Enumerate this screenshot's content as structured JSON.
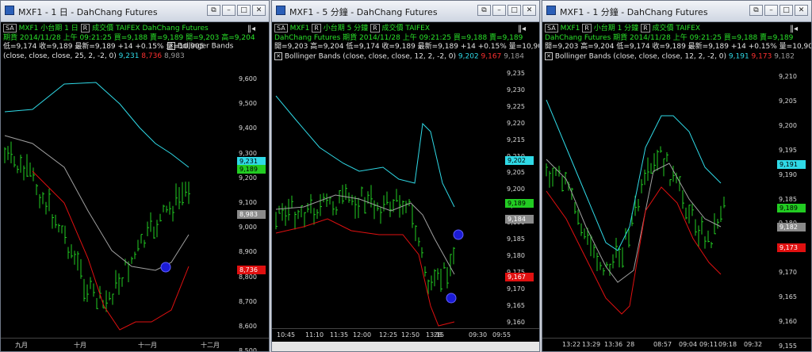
{
  "windows": [
    {
      "title": "MXF1 - 1 日 - DahChang Futures",
      "tab": "SA",
      "line1": {
        "sym": "MXF1",
        "name": "小台期 1 日",
        "btn": "R",
        "kind": "成交價",
        "exch": "TAIFEX",
        "src": "DahChang Futures"
      },
      "line2": "期貨  2014/11/28  上午 09:21:25  買=9,188  賣=9,189  開=9,203  高=9,204",
      "line3": "低=9,174  收=9,189  最新=9,189  +14  +0.15%  量=10,905",
      "indicator": "Bollinger Bands",
      "ind_params": "(close, close, close, 25, 2, -2, 0)",
      "ind_v1": "9,231",
      "ind_v2": "8,736",
      "ind_v3": "8,983",
      "y_ticks": [
        "9,600",
        "9,500",
        "9,400",
        "9,300",
        "9,200",
        "9,100",
        "9,000",
        "8,900",
        "8,800",
        "8,700",
        "8,600",
        "8,500"
      ],
      "x_ticks": [
        "九月",
        "十月",
        "十一月",
        "十二月"
      ],
      "price_tags": [
        {
          "label": "9,231",
          "color": "#2fd9e6",
          "text": "#000"
        },
        {
          "label": "9,189",
          "color": "#22cc22",
          "text": "#000"
        },
        {
          "label": "8,983",
          "color": "#8a8a8a",
          "text": "#fff"
        },
        {
          "label": "8,736",
          "color": "#e01010",
          "text": "#fff"
        }
      ]
    },
    {
      "title": "MXF1 - 5 分鐘 - DahChang Futures",
      "tab": "SA",
      "line1": {
        "sym": "MXF1",
        "name": "小台期 5 分鐘",
        "btn": "R",
        "kind": "成交價",
        "exch": "TAIFEX",
        "src": ""
      },
      "line2": "DahChang Futures  期貨  2014/11/28  上午 09:21:25  買=9,188  賣=9,189",
      "line3": "開=9,203  高=9,204  低=9,174  收=9,189  最新=9,189  +14  +0.15%  量=10,905",
      "indicator": "Bollinger Bands",
      "ind_params": "(close, close, close, 12, 2, -2, 0)",
      "ind_v1": "9,202",
      "ind_v2": "9,167",
      "ind_v3": "9,184",
      "y_ticks": [
        "9,235",
        "9,230",
        "9,225",
        "9,220",
        "9,215",
        "9,210",
        "9,205",
        "9,200",
        "9,195",
        "9,190",
        "9,185",
        "9,180",
        "9,175",
        "9,170",
        "9,165",
        "9,160"
      ],
      "x_ticks": [
        "10:45",
        "11:10",
        "11:35",
        "12:00",
        "12:25",
        "12:50",
        "13:15",
        "28",
        "09:30",
        "09:55"
      ],
      "price_tags": [
        {
          "label": "9,202",
          "color": "#2fd9e6",
          "text": "#000"
        },
        {
          "label": "9,189",
          "color": "#22cc22",
          "text": "#000"
        },
        {
          "label": "9,184",
          "color": "#8a8a8a",
          "text": "#fff"
        },
        {
          "label": "9,167",
          "color": "#e01010",
          "text": "#fff"
        }
      ]
    },
    {
      "title": "MXF1 - 1 分鐘 - DahChang Futures",
      "tab": "SA",
      "line1": {
        "sym": "MXF1",
        "name": "小台期 1 分鐘",
        "btn": "R",
        "kind": "成交價",
        "exch": "TAIFEX",
        "src": ""
      },
      "line2": "DahChang Futures  期貨  2014/11/28  上午 09:21:25  買=9,188  賣=9,189",
      "line3": "開=9,203  高=9,204  低=9,174  收=9,189  最新=9,189  +14  +0.15%  量=10,905",
      "indicator": "Bollinger Bands",
      "ind_params": "(close, close, close, 12, 2, -2, 0)",
      "ind_v1": "9,191",
      "ind_v2": "9,173",
      "ind_v3": "9,182",
      "y_ticks": [
        "9,210",
        "9,205",
        "9,200",
        "9,195",
        "9,190",
        "9,185",
        "9,180",
        "9,175",
        "9,170",
        "9,165",
        "9,160",
        "9,155"
      ],
      "x_ticks": [
        "13:22",
        "13:29",
        "13:36",
        "28",
        "08:57",
        "09:04",
        "09:11",
        "09:18",
        "09:32"
      ],
      "price_tags": [
        {
          "label": "9,191",
          "color": "#2fd9e6",
          "text": "#000"
        },
        {
          "label": "9,189",
          "color": "#22cc22",
          "text": "#000"
        },
        {
          "label": "9,182",
          "color": "#8a8a8a",
          "text": "#fff"
        },
        {
          "label": "9,173",
          "color": "#e01010",
          "text": "#fff"
        }
      ]
    }
  ],
  "colors": {
    "upper": "#2fd9e6",
    "mid": "#a0a0a0",
    "lower": "#e01010",
    "bars": "#22cc22",
    "marker": "#1b1bd6"
  }
}
